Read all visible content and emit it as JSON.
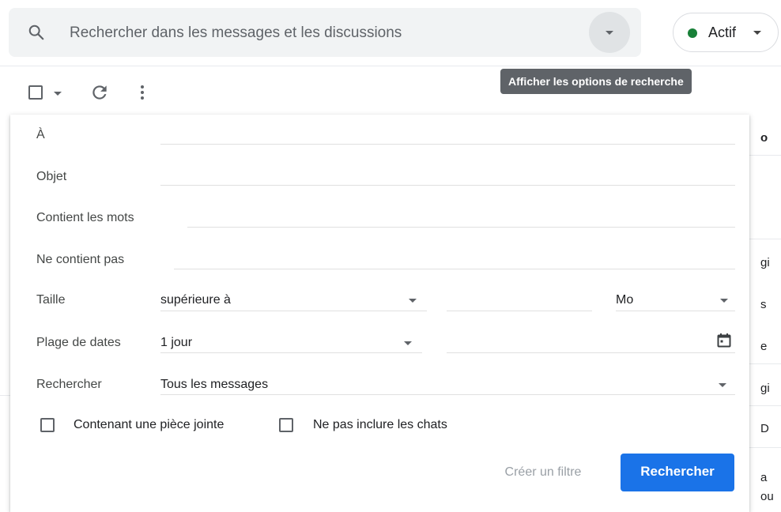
{
  "search": {
    "placeholder": "Rechercher dans les messages et les discussions",
    "options_tooltip": "Afficher les options de recherche"
  },
  "status": {
    "label": "Actif",
    "color": "#188038"
  },
  "advanced_search": {
    "fields": {
      "to_label": "À",
      "subject_label": "Objet",
      "has_words_label": "Contient les mots",
      "no_words_label": "Ne contient pas"
    },
    "size": {
      "label": "Taille",
      "operator": "supérieure à",
      "unit": "Mo"
    },
    "date_range": {
      "label": "Plage de dates",
      "value": "1 jour"
    },
    "search_in": {
      "label": "Rechercher",
      "value": "Tous les messages"
    },
    "checkboxes": {
      "has_attachment": "Contenant une pièce jointe",
      "exclude_chats": "Ne pas inclure les chats"
    },
    "buttons": {
      "create_filter": "Créer un filtre",
      "search": "Rechercher"
    }
  },
  "background_list": {
    "fragments": [
      "o",
      "gi",
      "s",
      "e",
      "gi",
      "D",
      "a",
      "ou"
    ]
  },
  "colors": {
    "accent": "#1a73e8",
    "tooltip_bg": "#5f6368"
  }
}
